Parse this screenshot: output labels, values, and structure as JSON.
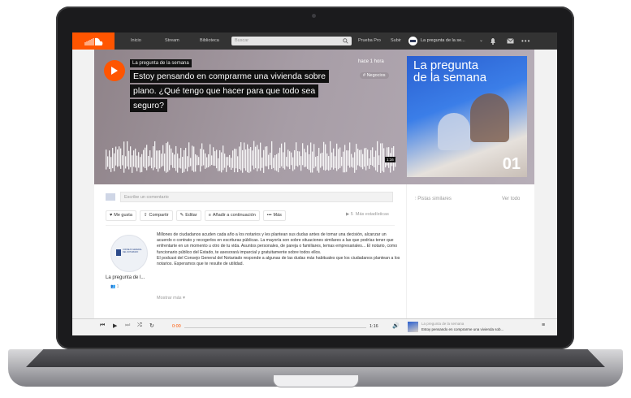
{
  "colors": {
    "accent": "#ff5500",
    "nav_bg": "#333333",
    "art_blue": "#2a5fd0"
  },
  "nav": {
    "links": [
      "Inicio",
      "Stream",
      "Biblioteca"
    ],
    "search_placeholder": "Buscar",
    "right_links": [
      "Prueba Pro",
      "Subir"
    ],
    "user_name": "La pregunta de la se...",
    "icons": [
      "search-icon",
      "bell-icon",
      "mail-icon",
      "more-icon"
    ]
  },
  "hero": {
    "artist": "La pregunta de la semana",
    "title_lines": [
      "Estoy pensando en comprarme una vivienda sobre",
      "plano. ¿Qué tengo que hacer para que todo sea",
      "seguro?"
    ],
    "time_ago": "hace 1 hora",
    "genre": "# Negocios",
    "duration": "1:16",
    "artwork_title": "La pregunta\nde la semana",
    "artwork_number": "01"
  },
  "comment": {
    "placeholder": "Escribe un comentario"
  },
  "actions": {
    "like": "Me gusta",
    "share": "Compartir",
    "edit": "Editar",
    "add_next": "Añadir a continuación",
    "more": "Más"
  },
  "stats": {
    "plays": "5",
    "more_stats": "Más estadísticas"
  },
  "user": {
    "name": "La pregunta de l...",
    "followers": "1",
    "logo_text": "CONSEJO GENERAL DEL NOTARIADO"
  },
  "description": "Millones de ciudadanos acuden cada año a los notarios y les plantean sus dudas antes de tomar una decisión, alcanzar un acuerdo o contrato y recogerlos en escrituras públicas. La mayoría son sobre situaciones similares a las que podrías tener que enfrentarte en un momento u otro de tu vida. Asuntos personales, de pareja o familiares, temas empresariales... El notario, como funcionario público del Estado, te asesorará imparcial y gratuitamente sobre todos ellos.\nEl podcast del Consejo General del Notariado responde a algunas de las dudas más habituales que los ciudadanos plantean a los notarios. Esperamos que te resulte de utilidad.",
  "show_more": "Mostrar más",
  "sidebar": {
    "heading": "Pistas similares",
    "view_all": "Ver todo"
  },
  "player": {
    "current": "0:00",
    "duration": "1:16",
    "now_playing_artist": "La pregunta de la semana",
    "now_playing_title": "Estoy pensando en comprarme una vivienda sob..."
  }
}
